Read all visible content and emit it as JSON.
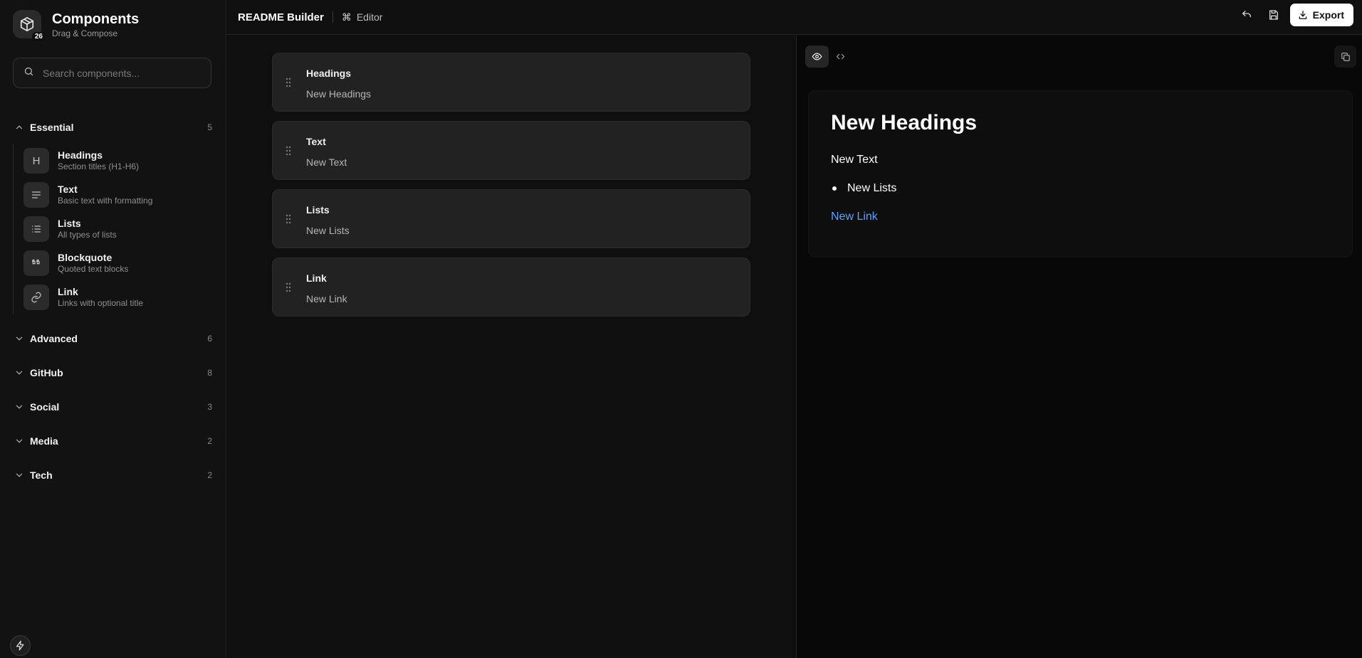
{
  "sidebar": {
    "brand": {
      "title": "Components",
      "subtitle": "Drag & Compose",
      "badge": "26"
    },
    "search": {
      "placeholder": "Search components..."
    },
    "categories": [
      {
        "name": "Essential",
        "count": "5",
        "expanded": true,
        "items": [
          {
            "title": "Headings",
            "desc": "Section titles (H1-H6)",
            "icon": "heading-icon"
          },
          {
            "title": "Text",
            "desc": "Basic text with formatting",
            "icon": "text-align-icon"
          },
          {
            "title": "Lists",
            "desc": "All types of lists",
            "icon": "list-icon"
          },
          {
            "title": "Blockquote",
            "desc": "Quoted text blocks",
            "icon": "quote-icon"
          },
          {
            "title": "Link",
            "desc": "Links with optional title",
            "icon": "link-icon"
          }
        ]
      },
      {
        "name": "Advanced",
        "count": "6",
        "expanded": false
      },
      {
        "name": "GitHub",
        "count": "8",
        "expanded": false
      },
      {
        "name": "Social",
        "count": "3",
        "expanded": false
      },
      {
        "name": "Media",
        "count": "2",
        "expanded": false
      },
      {
        "name": "Tech",
        "count": "2",
        "expanded": false
      }
    ],
    "heading_glyph": "H"
  },
  "topbar": {
    "title": "README Builder",
    "mode_symbol": "⌘",
    "mode_label": "Editor",
    "export_label": "Export"
  },
  "editor": {
    "blocks": [
      {
        "label": "Headings",
        "value": "New Headings"
      },
      {
        "label": "Text",
        "value": "New Text"
      },
      {
        "label": "Lists",
        "value": "New Lists"
      },
      {
        "label": "Link",
        "value": "New Link"
      }
    ]
  },
  "preview": {
    "active_tab": "preview",
    "heading": "New Headings",
    "text": "New Text",
    "list_items": [
      "New Lists"
    ],
    "link_text": "New Link",
    "link_color": "#5ea1ff"
  },
  "colors": {
    "background": "#0b0b0b",
    "sidebar": "#121212",
    "block": "#222222",
    "accent_button": "#ffffff"
  }
}
